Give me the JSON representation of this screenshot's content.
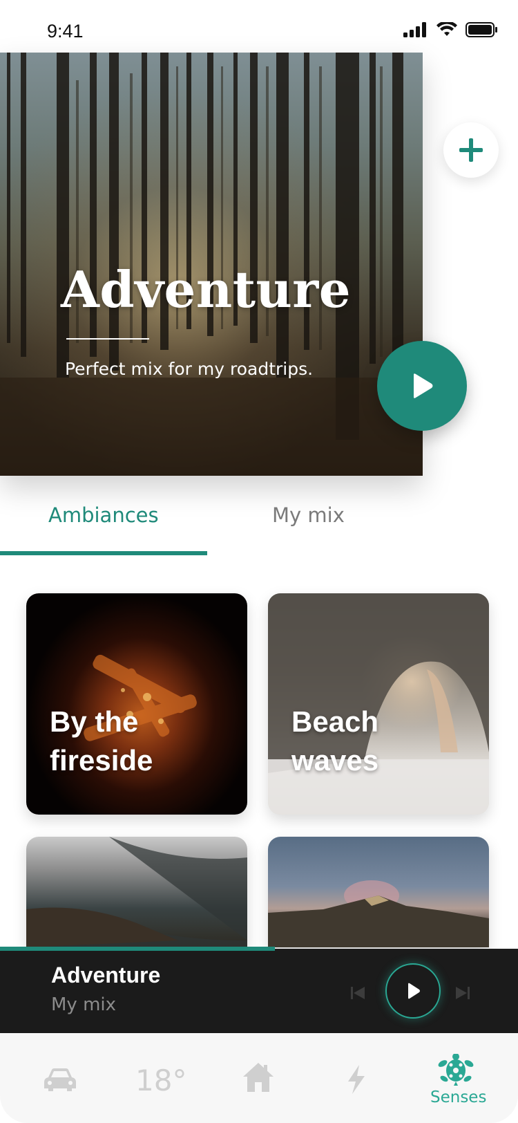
{
  "status_bar": {
    "time": "9:41"
  },
  "hero": {
    "title": "Adventure",
    "subtitle": "Perfect mix for my roadtrips."
  },
  "tabs": [
    {
      "label": "Ambiances",
      "active": true
    },
    {
      "label": "My mix",
      "active": false
    }
  ],
  "cards": [
    {
      "label_line1": "By the",
      "label_line2": "fireside"
    },
    {
      "label_line1": "Beach",
      "label_line2": "waves"
    },
    {
      "label_line1": "",
      "label_line2": ""
    },
    {
      "label_line1": "",
      "label_line2": ""
    }
  ],
  "player": {
    "title": "Adventure",
    "subtitle": "My mix",
    "progress": 0.53
  },
  "nav": {
    "temperature": "18°",
    "senses_label": "Senses",
    "items": [
      "car-icon",
      "temperature",
      "home-icon",
      "bolt-icon",
      "turtle-icon"
    ]
  },
  "colors": {
    "accent": "#1f8a7a",
    "player_bg": "#1b1b1b",
    "nav_bg": "#f7f7f7",
    "inactive_icon": "#cfcfcf"
  }
}
